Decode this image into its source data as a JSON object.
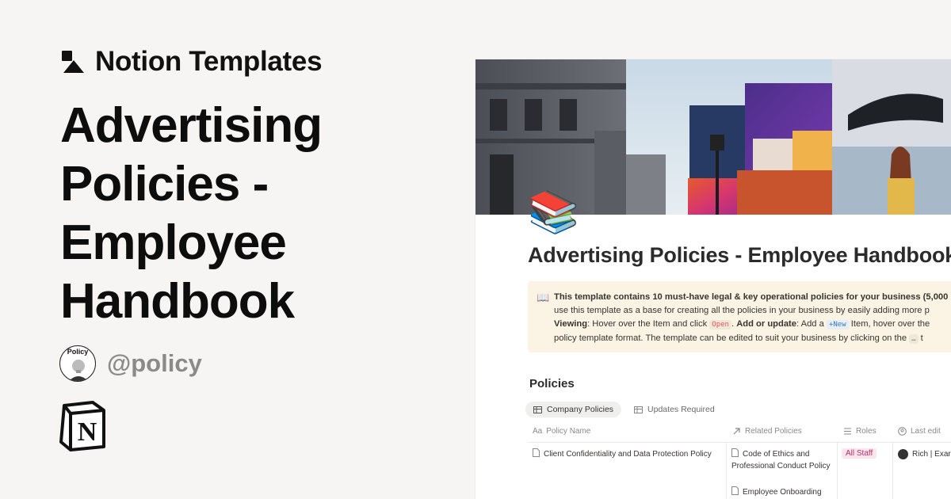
{
  "brand": {
    "name": "Notion Templates",
    "logo_icon": "notion-templates-logo-icon"
  },
  "hero": {
    "title": "Advertising Policies - Employee Handbook"
  },
  "author": {
    "avatar_label": "Policy",
    "handle": "@policy"
  },
  "notion_logo": {
    "letter": "N"
  },
  "page": {
    "icon": "📚",
    "title": "Advertising Policies - Employee Handbook",
    "callout": {
      "icon": "📖",
      "line1": "This template contains 10 must-have legal & key operational policies for your business (5,000",
      "line2": "use this template as a base for creating all the policies in your business by easily adding more p",
      "line3_bold1": "Viewing",
      "line3_text1": ": Hover over the Item and click ",
      "line3_code1": "Open",
      "line3_text2": ". ",
      "line3_bold2": "Add or update",
      "line3_text3": ": Add a ",
      "line3_code2": "+New",
      "line3_text4": " Item, hover over the",
      "line4_text": "policy template format. The template can be edited to suit your business by clicking on the ",
      "line4_code": "…",
      "line4_tail": " t"
    },
    "section_title": "Policies",
    "tabs": [
      {
        "label": "Company Policies",
        "active": true
      },
      {
        "label": "Updates Required",
        "active": false
      }
    ],
    "columns": {
      "policy_name": "Policy Name",
      "related": "Related Policies",
      "roles": "Roles",
      "last_edit": "Last edit"
    },
    "rows": [
      {
        "policy_name": "Client Confidentiality and Data Protection Policy",
        "related": [
          "Code of Ethics and Professional Conduct Policy",
          "Employee Onboarding"
        ],
        "role": "All Staff",
        "last_edit": "Rich | Exar"
      }
    ],
    "colors": {
      "callout_bg": "#fbf3e4",
      "role_tag": "#fbe4ec"
    }
  }
}
